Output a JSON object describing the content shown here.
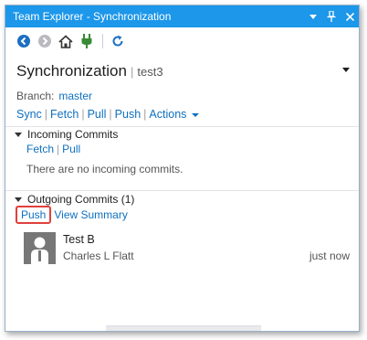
{
  "window": {
    "title": "Team Explorer - Synchronization",
    "title_buttons": [
      "dropdown-icon",
      "pin-icon",
      "close-icon"
    ]
  },
  "toolbar": {
    "icons": [
      "back-icon",
      "forward-icon",
      "home-icon",
      "connect-icon",
      "refresh-icon"
    ]
  },
  "header": {
    "title": "Synchronization",
    "separator": "|",
    "repo": "test3"
  },
  "branch": {
    "label": "Branch:",
    "value": "master"
  },
  "actions": {
    "sync": "Sync",
    "fetch": "Fetch",
    "pull": "Pull",
    "push": "Push",
    "more": "Actions",
    "separator": "|"
  },
  "incoming": {
    "title": "Incoming Commits",
    "fetch": "Fetch",
    "pull": "Pull",
    "separator": "|",
    "empty_text": "There are no incoming commits."
  },
  "outgoing": {
    "title": "Outgoing Commits (1)",
    "push": "Push",
    "view_summary": "View Summary",
    "commits": [
      {
        "message": "Test B",
        "author": "Charles L Flatt",
        "time": "just now"
      }
    ]
  },
  "colors": {
    "titlebar": "#1c97ea",
    "link": "#0e70c0",
    "highlight_box": "#e0403c",
    "avatar": "#777777"
  }
}
